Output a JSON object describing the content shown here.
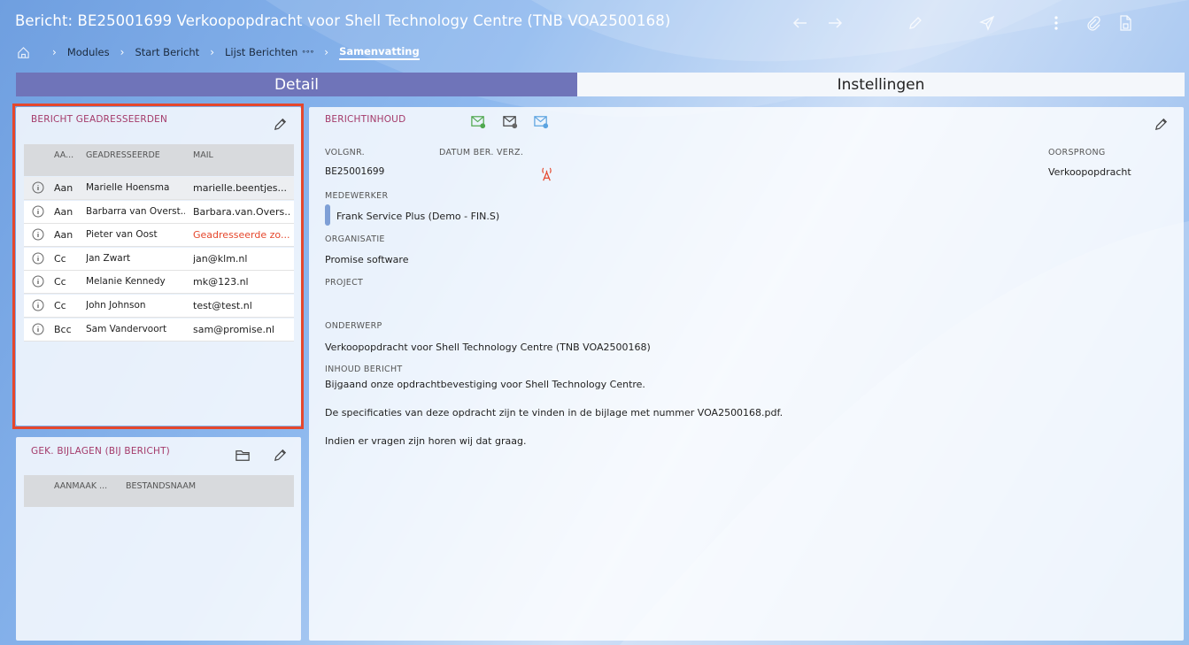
{
  "header": {
    "title": "Bericht: BE25001699 Verkoopopdracht voor Shell Technology Centre (TNB VOA2500168)",
    "icons": [
      "arrow-left-icon",
      "arrow-right-icon",
      "pencil-icon",
      "send-icon",
      "more-vertical-icon",
      "paperclip-icon",
      "document-icon"
    ]
  },
  "breadcrumb": {
    "items": [
      "Modules",
      "Start Bericht",
      "Lijst Berichten"
    ],
    "more": "∘∘∘",
    "active": "Samenvatting"
  },
  "tabs": [
    "Detail",
    "Instellingen"
  ],
  "addressees": {
    "title": "BERICHT GEADRESSEERDEN",
    "columns": [
      "AA...",
      "GEADRESSEERDE",
      "MAIL"
    ],
    "rows": [
      {
        "type": "Aan",
        "name": "Marielle Hoensma",
        "mail": "marielle.beentjes..."
      },
      {
        "type": "Aan",
        "name": "Barbarra van Overst...",
        "mail": "Barbara.van.Overs..."
      },
      {
        "type": "Aan",
        "name": "Pieter van Oost",
        "mail": "Geadresseerde zo..."
      },
      {
        "type": "Cc",
        "name": "Jan Zwart",
        "mail": "jan@klm.nl"
      },
      {
        "type": "Cc",
        "name": "Melanie Kennedy",
        "mail": "mk@123.nl"
      },
      {
        "type": "Cc",
        "name": "John Johnson",
        "mail": "test@test.nl"
      },
      {
        "type": "Bcc",
        "name": "Sam Vandervoort",
        "mail": "sam@promise.nl"
      }
    ],
    "warning_color": "#e5472c"
  },
  "attachments": {
    "title": "GEK. BIJLAGEN (BIJ BERICHT)",
    "columns": [
      "AANMAAK ...",
      "BESTANDSNAAM"
    ]
  },
  "message": {
    "title": "BERICHTINHOUD",
    "volgnr_label": "VOLGNR.",
    "volgnr": "BE25001699",
    "datum_label": "DATUM BER. VERZ.",
    "oorsprong_label": "OORSPRONG",
    "oorsprong": "Verkoopopdracht",
    "medewerker_label": "MEDEWERKER",
    "medewerker": "Frank Service Plus (Demo - FIN.S)",
    "organisatie_label": "ORGANISATIE",
    "organisatie": "Promise software",
    "project_label": "PROJECT",
    "onderwerp_label": "ONDERWERP",
    "onderwerp": "Verkoopopdracht voor Shell Technology Centre (TNB VOA2500168)",
    "inhoud_label": "INHOUD BERICHT",
    "body": [
      "Bijgaand onze opdrachtbevestiging voor Shell Technology Centre.",
      "De specificaties van deze opdracht zijn te vinden in de bijlage met nummer VOA2500168.pdf.",
      "Indien er vragen zijn horen wij dat graag."
    ]
  },
  "colors": {
    "accent_tab": "#6f74b9",
    "title_color": "#a43a6a",
    "highlight": "#e5472c"
  }
}
